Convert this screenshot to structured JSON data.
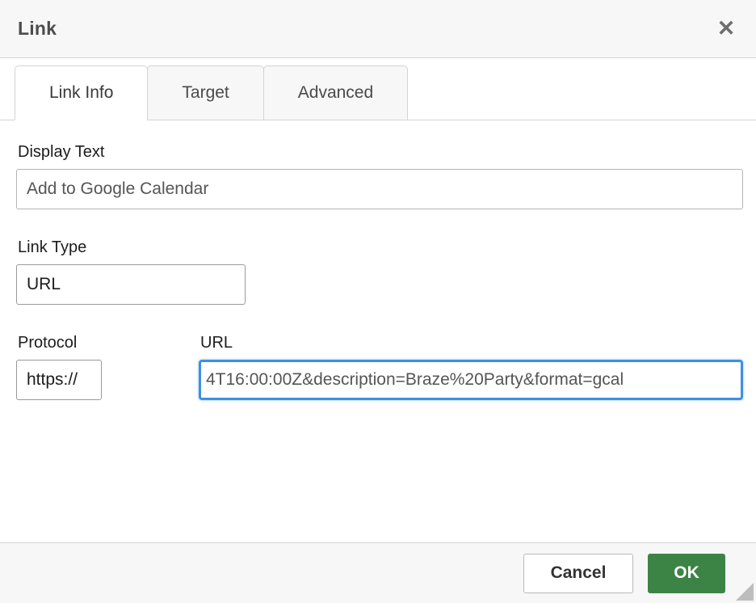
{
  "dialog": {
    "title": "Link",
    "close_icon": "close-icon"
  },
  "tabs": [
    {
      "label": "Link Info",
      "active": true
    },
    {
      "label": "Target",
      "active": false
    },
    {
      "label": "Advanced",
      "active": false
    }
  ],
  "form": {
    "display_text": {
      "label": "Display Text",
      "value": "Add to Google Calendar"
    },
    "link_type": {
      "label": "Link Type",
      "value": "URL"
    },
    "protocol": {
      "label": "Protocol",
      "value": "https://"
    },
    "url": {
      "label": "URL",
      "value": "4T16:00:00Z&description=Braze%20Party&format=gcal"
    }
  },
  "footer": {
    "cancel_label": "Cancel",
    "ok_label": "OK",
    "resize_grip_icon": "resize-grip-icon"
  },
  "colors": {
    "accent_green": "#3c8445",
    "focus_blue": "#3d90e3",
    "titlebar_bg": "#f7f7f7",
    "border_gray": "#d4d4d4"
  }
}
